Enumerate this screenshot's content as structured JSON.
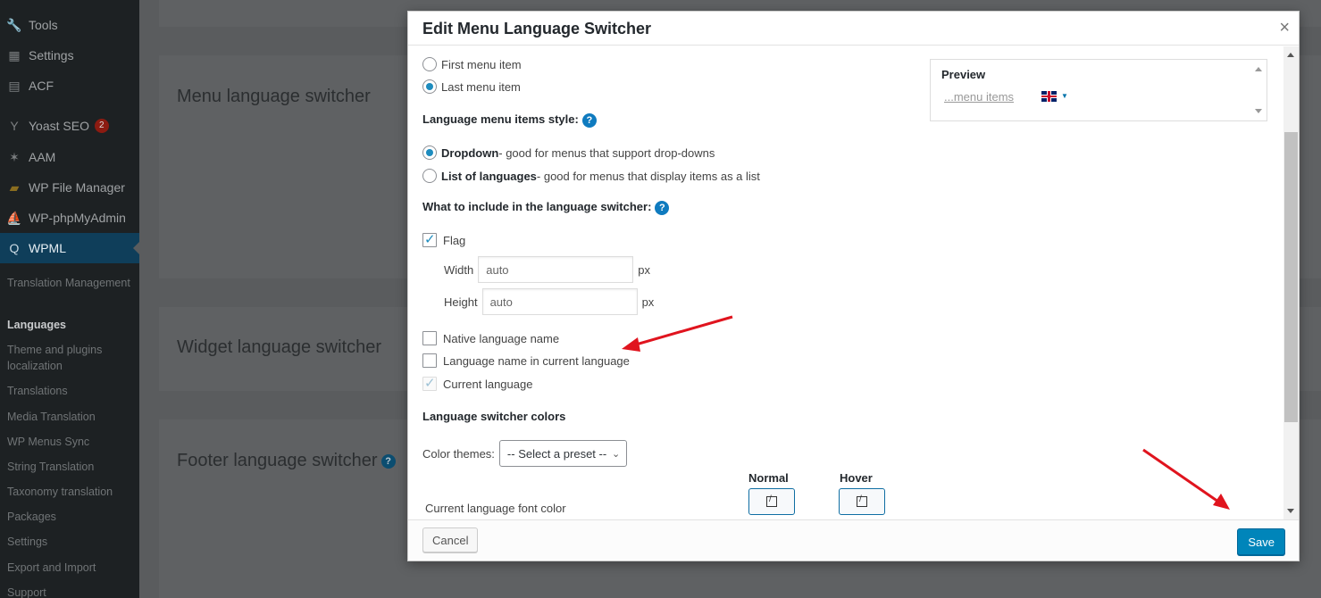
{
  "sidebar": {
    "menu": [
      {
        "label": "Tools",
        "icon": "wrench-icon"
      },
      {
        "label": "Settings",
        "icon": "settings-icon"
      },
      {
        "label": "ACF",
        "icon": "acf-icon"
      },
      {
        "label": "Yoast SEO",
        "icon": "yoast-icon",
        "badge": "2"
      },
      {
        "label": "AAM",
        "icon": "aam-icon"
      },
      {
        "label": "WP File Manager",
        "icon": "folder-icon"
      },
      {
        "label": "WP-phpMyAdmin",
        "icon": "phpmyadmin-icon"
      },
      {
        "label": "WPML",
        "icon": "wpml-icon"
      }
    ],
    "submenu": [
      "Translation Management",
      "Languages",
      "Theme and plugins localization",
      "Translations",
      "Media Translation",
      "WP Menus Sync",
      "String Translation",
      "Taxonomy translation",
      "Packages",
      "Settings",
      "Export and Import",
      "Support"
    ]
  },
  "background": {
    "menu_switcher_title": "Menu language switcher",
    "widget_switcher_title": "Widget language switcher",
    "footer_switcher_title": "Footer language switcher",
    "help_glyph": "?"
  },
  "modal": {
    "title": "Edit Menu Language Switcher",
    "close_glyph": "×",
    "position_options": [
      {
        "label": "First menu item",
        "checked": false
      },
      {
        "label": "Last menu item",
        "checked": true
      }
    ],
    "style_label": "Language menu items style:",
    "style_options": [
      {
        "bold": "Dropdown",
        "rest": " - good for menus that support drop-downs",
        "checked": true
      },
      {
        "bold": "List of languages",
        "rest": " - good for menus that display items as a list",
        "checked": false
      }
    ],
    "include_label": "What to include in the language switcher:",
    "flag_label": "Flag",
    "flag_checked": true,
    "width_label": "Width",
    "width_value": "auto",
    "height_label": "Height",
    "height_value": "auto",
    "unit": "px",
    "native_label": "Native language name",
    "current_name_label": "Language name in current language",
    "current_language_label": "Current language",
    "colors_label": "Language switcher colors",
    "color_themes_label": "Color themes:",
    "preset_value": "-- Select a preset --",
    "normal_label": "Normal",
    "hover_label": "Hover",
    "font_color_label": "Current language font color",
    "preview_title": "Preview",
    "preview_link": "...menu items",
    "cancel_label": "Cancel",
    "save_label": "Save"
  },
  "colors": {
    "primary": "#0085ba",
    "annotation": "#e0141e"
  }
}
